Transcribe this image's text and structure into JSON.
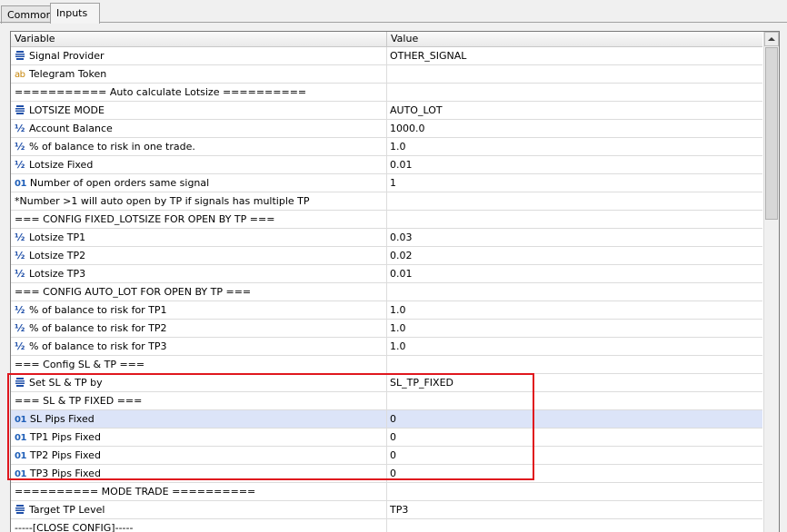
{
  "tabs": [
    {
      "label": "Common"
    },
    {
      "label": "Inputs"
    }
  ],
  "grid": {
    "columns": {
      "variable": "Variable",
      "value": "Value"
    },
    "rows": [
      {
        "icon": "enum-icon",
        "variable": "Signal Provider",
        "value": "OTHER_SIGNAL"
      },
      {
        "icon": "text-icon",
        "variable": "Telegram Token",
        "value": ""
      },
      {
        "icon": "",
        "variable": "=========== Auto calculate Lotsize ==========",
        "value": ""
      },
      {
        "icon": "enum-icon",
        "variable": "LOTSIZE MODE",
        "value": "AUTO_LOT"
      },
      {
        "icon": "double-icon",
        "variable": "Account Balance",
        "value": "1000.0"
      },
      {
        "icon": "double-icon",
        "variable": "% of balance to risk in one trade.",
        "value": "1.0"
      },
      {
        "icon": "double-icon",
        "variable": "Lotsize Fixed",
        "value": "0.01"
      },
      {
        "icon": "integer-icon",
        "variable": "Number of open orders same signal",
        "value": "1"
      },
      {
        "icon": "",
        "variable": "*Number >1 will auto open by TP if signals has multiple TP",
        "value": ""
      },
      {
        "icon": "",
        "variable": "=== CONFIG FIXED_LOTSIZE FOR OPEN BY TP ===",
        "value": ""
      },
      {
        "icon": "double-icon",
        "variable": "Lotsize TP1",
        "value": "0.03"
      },
      {
        "icon": "double-icon",
        "variable": "Lotsize TP2",
        "value": "0.02"
      },
      {
        "icon": "double-icon",
        "variable": "Lotsize TP3",
        "value": "0.01"
      },
      {
        "icon": "",
        "variable": "=== CONFIG AUTO_LOT FOR OPEN BY TP ===",
        "value": ""
      },
      {
        "icon": "double-icon",
        "variable": "% of balance to risk for TP1",
        "value": "1.0"
      },
      {
        "icon": "double-icon",
        "variable": "% of balance to risk for TP2",
        "value": "1.0"
      },
      {
        "icon": "double-icon",
        "variable": "% of balance to risk for TP3",
        "value": "1.0"
      },
      {
        "icon": "",
        "variable": "=== Config SL & TP ===",
        "value": ""
      },
      {
        "icon": "enum-icon",
        "variable": "Set SL & TP by",
        "value": "SL_TP_FIXED"
      },
      {
        "icon": "",
        "variable": "=== SL & TP FIXED ===",
        "value": ""
      },
      {
        "icon": "integer-icon",
        "variable": "SL Pips Fixed",
        "value": "0",
        "selected": true
      },
      {
        "icon": "integer-icon",
        "variable": "TP1 Pips Fixed",
        "value": "0"
      },
      {
        "icon": "integer-icon",
        "variable": "TP2 Pips Fixed",
        "value": "0"
      },
      {
        "icon": "integer-icon",
        "variable": "TP3 Pips Fixed",
        "value": "0"
      },
      {
        "icon": "",
        "variable": "========== MODE TRADE ==========",
        "value": ""
      },
      {
        "icon": "enum-icon",
        "variable": "Target TP Level",
        "value": "TP3"
      },
      {
        "icon": "",
        "variable": "-----[CLOSE CONFIG]-----",
        "value": ""
      }
    ]
  },
  "icon_glyphs": {
    "text-icon": "ab",
    "double-icon": "½",
    "integer-icon": "01"
  },
  "colors": {
    "highlight": "#e0171e",
    "selected_row": "#dce4f8"
  }
}
